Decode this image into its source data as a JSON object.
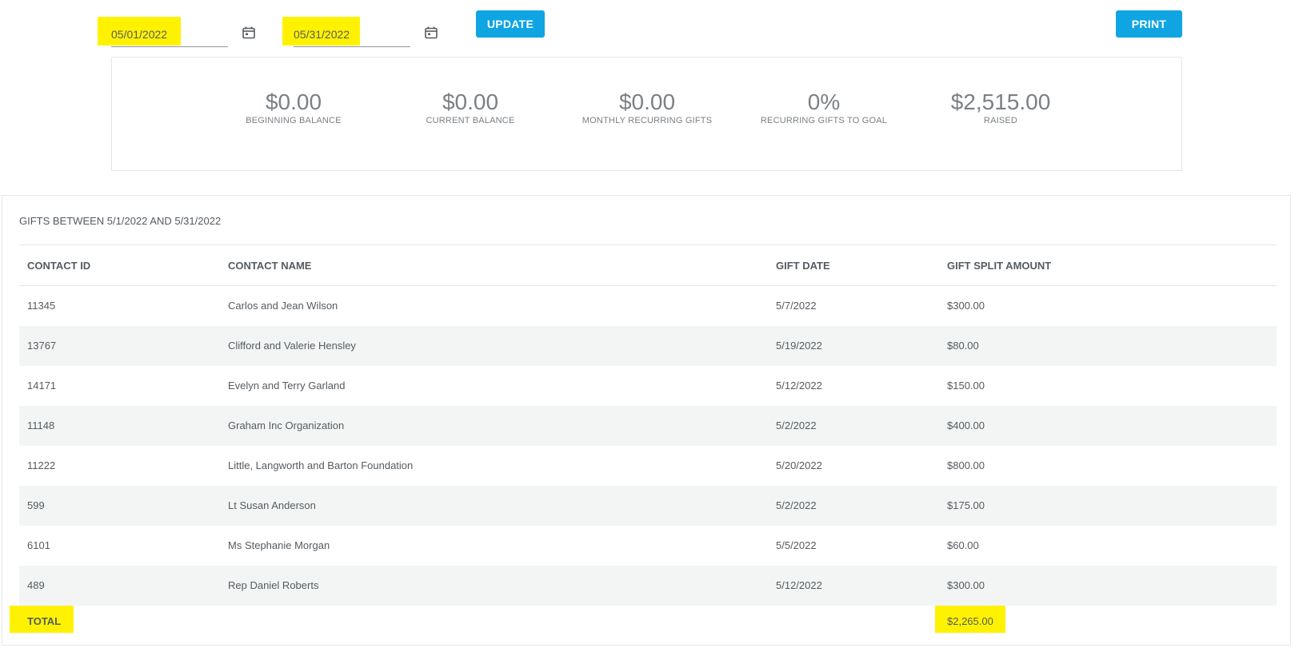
{
  "filters": {
    "start_date": "05/01/2022",
    "end_date": "05/31/2022",
    "update_label": "UPDATE",
    "print_label": "PRINT"
  },
  "summary": {
    "stats": [
      {
        "value": "$0.00",
        "label": "BEGINNING BALANCE"
      },
      {
        "value": "$0.00",
        "label": "CURRENT BALANCE"
      },
      {
        "value": "$0.00",
        "label": "MONTHLY RECURRING GIFTS"
      },
      {
        "value": "0%",
        "label": "RECURRING GIFTS TO GOAL"
      },
      {
        "value": "$2,515.00",
        "label": "RAISED"
      }
    ]
  },
  "gifts": {
    "title": "GIFTS BETWEEN 5/1/2022 AND 5/31/2022",
    "columns": [
      "CONTACT ID",
      "CONTACT NAME",
      "GIFT DATE",
      "GIFT SPLIT AMOUNT"
    ],
    "rows": [
      {
        "id": "11345",
        "name": "Carlos and Jean Wilson",
        "date": "5/7/2022",
        "amount": "$300.00"
      },
      {
        "id": "13767",
        "name": "Clifford and Valerie Hensley",
        "date": "5/19/2022",
        "amount": "$80.00"
      },
      {
        "id": "14171",
        "name": "Evelyn and Terry Garland",
        "date": "5/12/2022",
        "amount": "$150.00"
      },
      {
        "id": "11148",
        "name": "Graham Inc Organization",
        "date": "5/2/2022",
        "amount": "$400.00"
      },
      {
        "id": "11222",
        "name": "Little, Langworth and Barton Foundation",
        "date": "5/20/2022",
        "amount": "$800.00"
      },
      {
        "id": "599",
        "name": "Lt Susan Anderson",
        "date": "5/2/2022",
        "amount": "$175.00"
      },
      {
        "id": "6101",
        "name": "Ms Stephanie Morgan",
        "date": "5/5/2022",
        "amount": "$60.00"
      },
      {
        "id": "489",
        "name": "Rep Daniel Roberts",
        "date": "5/12/2022",
        "amount": "$300.00"
      }
    ],
    "total_label": "TOTAL",
    "total_amount": "$2,265.00"
  },
  "colors": {
    "accent": "#0ea5e2",
    "highlight": "#fff200",
    "stripe": "#f3f5f5"
  },
  "icons": {
    "calendar": "calendar-icon"
  }
}
